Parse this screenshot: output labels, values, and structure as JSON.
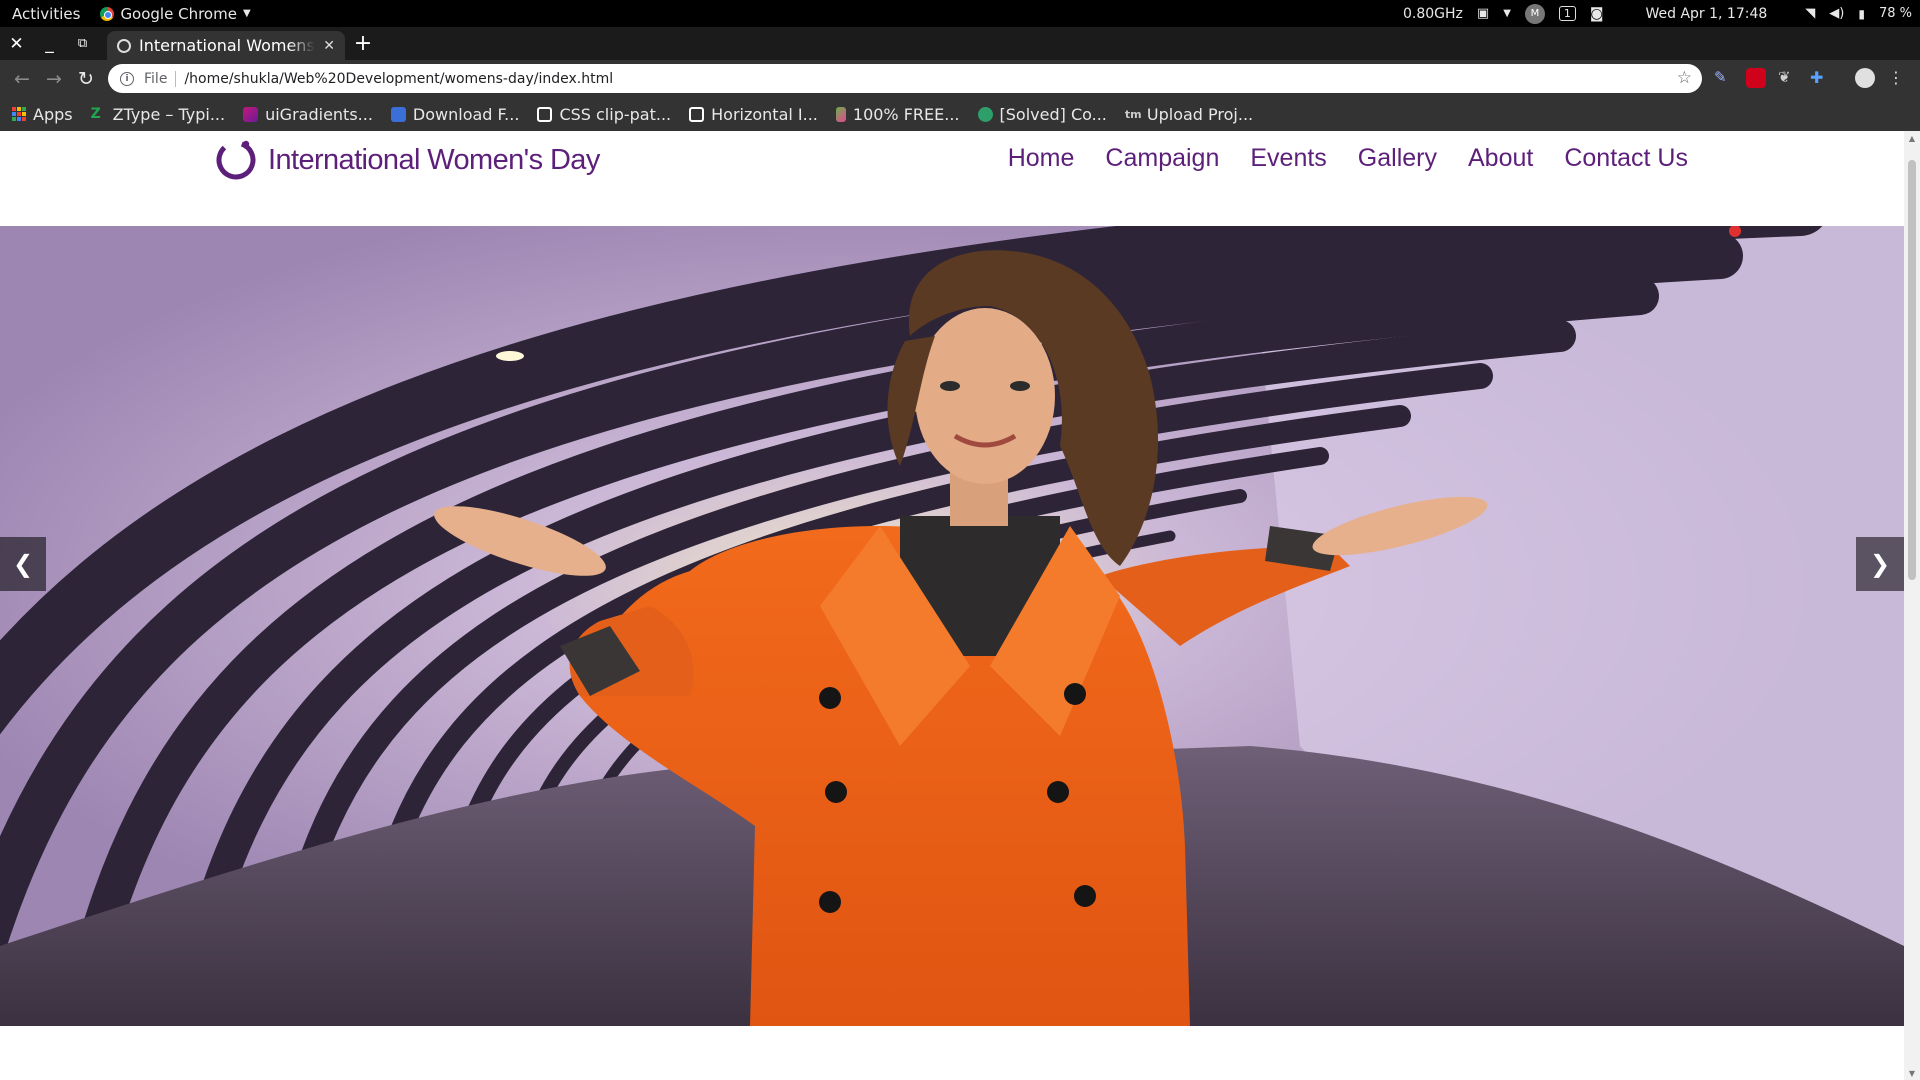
{
  "system_bar": {
    "activities": "Activities",
    "app_name": "Google Chrome",
    "cpu": "0.80GHz",
    "workspace": "1",
    "datetime": "Wed Apr  1, 17:48",
    "battery": "78 %"
  },
  "browser": {
    "tab_title": "International Womens Day",
    "omnibox_scheme": "File",
    "url": "/home/shukla/Web%20Development/womens-day/index.html",
    "bookmarks": [
      {
        "label": "Apps"
      },
      {
        "label": "ZType – Typi...",
        "color": "#1fa84f"
      },
      {
        "label": "uiGradients...",
        "color": "#c2187a"
      },
      {
        "label": "Download F...",
        "color": "#3a6fd8"
      },
      {
        "label": "CSS clip-pat...",
        "color": "#ffffff"
      },
      {
        "label": "Horizontal I...",
        "color": "#ffffff"
      },
      {
        "label": "100% FREE...",
        "color": "#6ab04c"
      },
      {
        "label": "[Solved] Co...",
        "color": "#2e9e6a"
      },
      {
        "label": "Upload Proj...",
        "color": "#cccccc"
      }
    ]
  },
  "site": {
    "logo_text": "International Women's Day",
    "brand_color": "#5c1f7a",
    "nav": [
      "Home",
      "Campaign",
      "Events",
      "Gallery",
      "About",
      "Contact Us"
    ],
    "carousel": {
      "prev": "❮",
      "next": "❯"
    }
  }
}
